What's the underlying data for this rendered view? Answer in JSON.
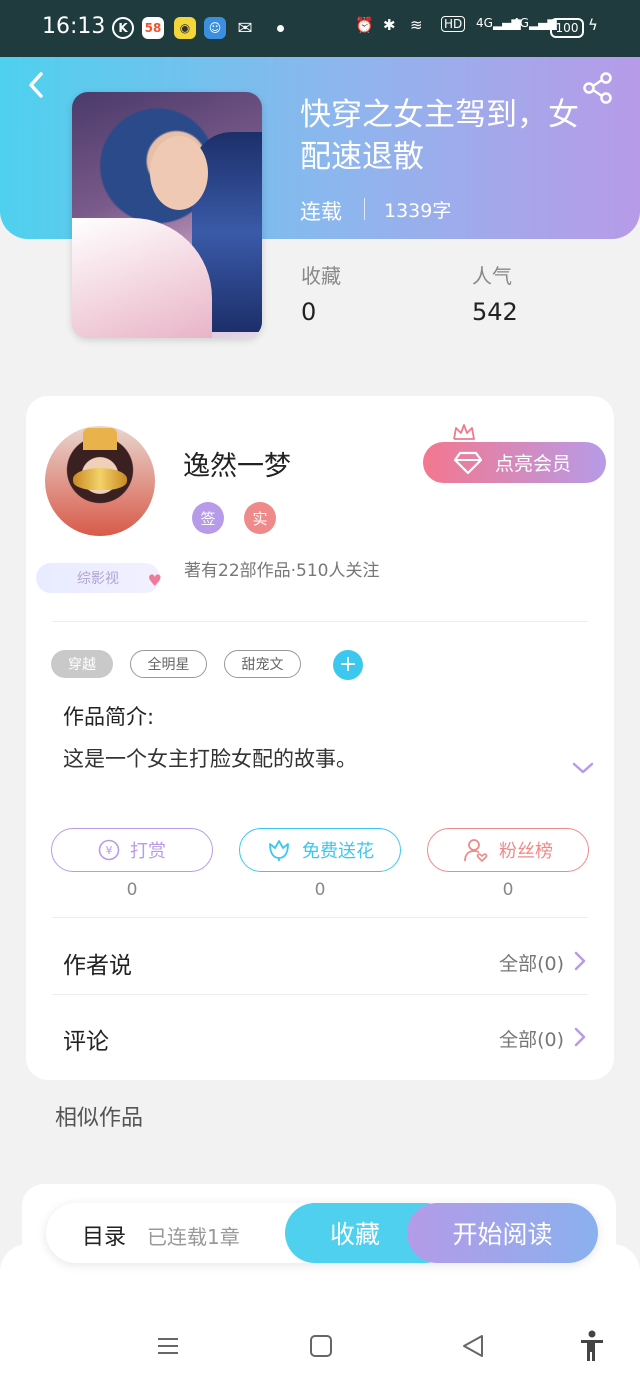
{
  "status_bar": {
    "time": "16:13",
    "apps": [
      "K",
      "58"
    ],
    "signal": [
      "HD",
      "4G",
      "4G"
    ],
    "battery": "100"
  },
  "book": {
    "title": "快穿之女主驾到，女配速退散",
    "status": "连载",
    "word_count": "1339字",
    "favorites_label": "收藏",
    "favorites_value": "0",
    "popularity_label": "人气",
    "popularity_value": "542"
  },
  "author": {
    "name": "逸然一梦",
    "badge_sign": "签",
    "badge_real": "实",
    "genre_badge": "综影视",
    "meta": "著有22部作品·510人关注",
    "vip_button": "点亮会员"
  },
  "tags": [
    "穿越",
    "全明星",
    "甜宠文"
  ],
  "tag_add": "+",
  "intro": {
    "title": "作品简介:",
    "text": "这是一个女主打脸女配的故事。"
  },
  "actions": [
    {
      "label": "打赏",
      "count": "0",
      "color": "#b79be8"
    },
    {
      "label": "免费送花",
      "count": "0",
      "color": "#3cc8ee"
    },
    {
      "label": "粉丝榜",
      "count": "0",
      "color": "#f08a8a"
    }
  ],
  "rows": [
    {
      "label": "作者说",
      "right": "全部(0)"
    },
    {
      "label": "评论",
      "right": "全部(0)"
    }
  ],
  "similar_title": "相似作品",
  "bottom_bar": {
    "toc": "目录",
    "chapters": "已连载1章",
    "collect": "收藏",
    "read": "开始阅读"
  },
  "colors": {
    "accent_cyan": "#4fd0ef",
    "accent_purple": "#b79be8",
    "accent_pink": "#f4778e"
  }
}
